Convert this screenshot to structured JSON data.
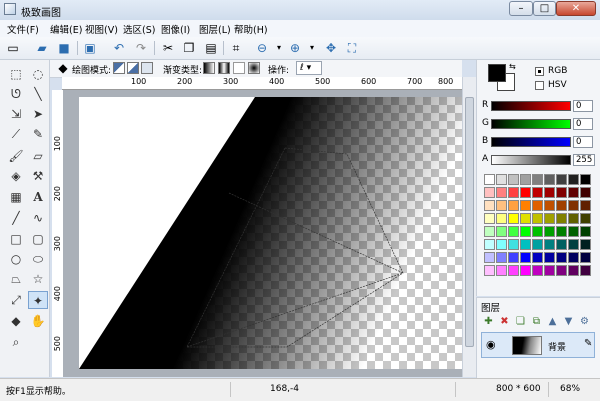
{
  "window": {
    "title": "极致画图",
    "min_label": "–",
    "max_label": "□",
    "close_label": "✕"
  },
  "menu": {
    "items": [
      "文件(F)",
      "编辑(E)",
      "视图(V)",
      "选区(S)",
      "图像(I)",
      "图层(L)",
      "帮助(H)"
    ]
  },
  "options_bar": {
    "draw_mode_label": "绘图模式:",
    "gradient_type_label": "渐变类型:",
    "operation_label": "操作:",
    "operation_value": "ℓ ▾"
  },
  "rulers": {
    "top": [
      "100",
      "200",
      "300",
      "400",
      "500",
      "600",
      "700",
      "800"
    ],
    "left": [
      "100",
      "200",
      "300",
      "400",
      "500"
    ]
  },
  "colors": {
    "mode_rgb": "RGB",
    "mode_hsv": "HSV",
    "r_label": "R",
    "r_value": "0",
    "g_label": "G",
    "g_value": "0",
    "b_label": "B",
    "b_value": "0",
    "a_label": "A",
    "a_value": "255",
    "primary": "#000000",
    "secondary": "#ffffff"
  },
  "palette": [
    "#ffffff",
    "#e0e0e0",
    "#c0c0c0",
    "#a0a0a0",
    "#808080",
    "#606060",
    "#404040",
    "#202020",
    "#000000",
    "#ffc0c0",
    "#ff8080",
    "#ff4040",
    "#ff0000",
    "#c00000",
    "#a00000",
    "#800000",
    "#600000",
    "#400000",
    "#ffe0c0",
    "#ffc080",
    "#ffa040",
    "#ff8000",
    "#e06000",
    "#c05000",
    "#a04000",
    "#803000",
    "#602000",
    "#ffffc0",
    "#ffff80",
    "#ffff00",
    "#e0e000",
    "#c0c000",
    "#a0a000",
    "#808000",
    "#606000",
    "#404000",
    "#c0ffc0",
    "#80ff80",
    "#40ff40",
    "#00ff00",
    "#00c000",
    "#00a000",
    "#008000",
    "#006000",
    "#004000",
    "#c0ffff",
    "#80ffff",
    "#40e0e0",
    "#00c0c0",
    "#00a0a0",
    "#008080",
    "#006060",
    "#004040",
    "#002020",
    "#c0c0ff",
    "#8080ff",
    "#4040ff",
    "#0000ff",
    "#0000c0",
    "#0000a0",
    "#000080",
    "#000060",
    "#000040",
    "#ffc0ff",
    "#ff80ff",
    "#ff40ff",
    "#ff00ff",
    "#c000c0",
    "#a000a0",
    "#800080",
    "#600060",
    "#400040"
  ],
  "layers": {
    "title": "图层",
    "items": [
      {
        "name": "背景"
      }
    ]
  },
  "status": {
    "help": "按F1显示帮助。",
    "coords": "168,-4",
    "size": "800 * 600",
    "zoom": "68%"
  }
}
